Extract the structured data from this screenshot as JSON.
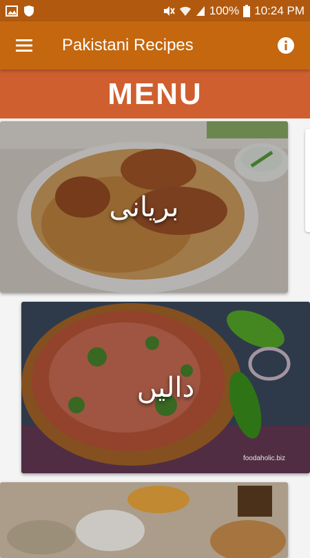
{
  "status_bar": {
    "battery": "100%",
    "time": "10:24 PM"
  },
  "app_bar": {
    "title": "Pakistani Recipes"
  },
  "menu_header": {
    "title": "MENU"
  },
  "cards": [
    {
      "label": "بریانی"
    },
    {
      "label": "دالیں",
      "watermark": "foodaholic.biz"
    },
    {
      "label": ""
    }
  ],
  "colors": {
    "status_bar": "#b15a0f",
    "app_bar": "#c4670f",
    "menu_header": "#cf5f2f"
  }
}
